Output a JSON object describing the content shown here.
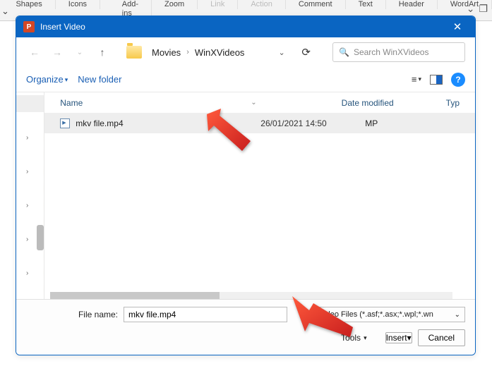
{
  "ribbon": {
    "items": [
      "Shapes",
      "Icons",
      "Add-ins",
      "Zoom",
      "Link",
      "Action",
      "Comment",
      "Text",
      "Header",
      "WordArt"
    ]
  },
  "dialog": {
    "title": "Insert Video"
  },
  "breadcrumb": {
    "parent": "Movies",
    "current": "WinXVideos"
  },
  "search": {
    "placeholder": "Search WinXVideos"
  },
  "toolbar": {
    "organize": "Organize",
    "newfolder": "New folder"
  },
  "columns": {
    "name": "Name",
    "date": "Date modified",
    "type": "Typ"
  },
  "file": {
    "name": "mkv file.mp4",
    "date": "26/01/2021 14:50",
    "type": "MP"
  },
  "footer": {
    "filename_label": "File name:",
    "filename_value": "mkv file.mp4",
    "filter": "Video Files (*.asf;*.asx;*.wpl;*.wn",
    "tools": "Tools",
    "insert": "Insert",
    "cancel": "Cancel"
  }
}
